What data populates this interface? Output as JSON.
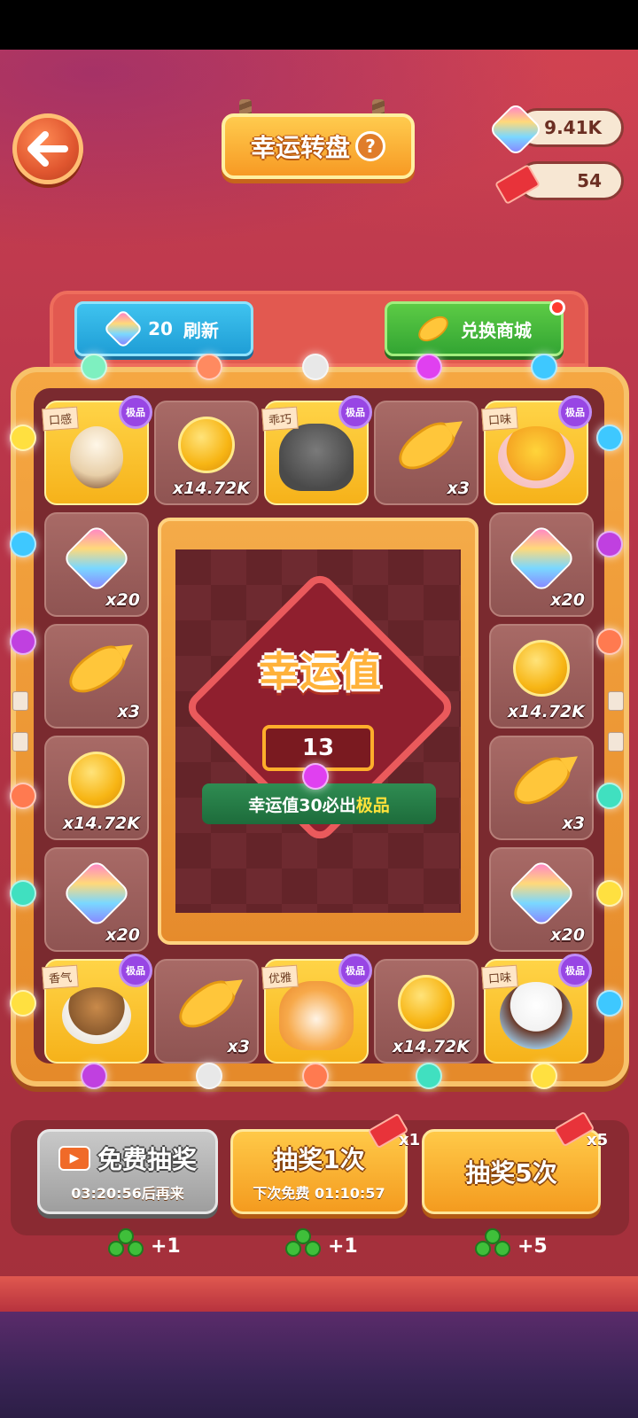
{
  "header": {
    "title": "幸运转盘",
    "help_label": "?",
    "gem_balance": "9.41K",
    "ticket_balance": "54"
  },
  "tabs": {
    "refresh_count": "20",
    "refresh_label": "刷新",
    "shop_label": "兑换商城"
  },
  "grid": {
    "rare_badge": "极品",
    "top_row": [
      {
        "type": "food",
        "tag": "口感",
        "rare": true,
        "item": "coffee-cup"
      },
      {
        "type": "coin",
        "count": "x14.72K"
      },
      {
        "type": "pet",
        "tag": "乖巧",
        "rare": true,
        "item": "gray-cat"
      },
      {
        "type": "fish",
        "count": "x3"
      },
      {
        "type": "food",
        "tag": "口味",
        "rare": true,
        "item": "bee-dish"
      }
    ],
    "left_col": [
      {
        "type": "gem",
        "count": "x20"
      },
      {
        "type": "fish",
        "count": "x3"
      },
      {
        "type": "coin",
        "count": "x14.72K"
      },
      {
        "type": "gem",
        "count": "x20"
      }
    ],
    "right_col": [
      {
        "type": "gem",
        "count": "x20"
      },
      {
        "type": "coin",
        "count": "x14.72K"
      },
      {
        "type": "fish",
        "count": "x3"
      },
      {
        "type": "gem",
        "count": "x20"
      }
    ],
    "bottom_row": [
      {
        "type": "food",
        "tag": "香气",
        "rare": true,
        "item": "bear-latte"
      },
      {
        "type": "fish",
        "count": "x3"
      },
      {
        "type": "pet",
        "tag": "优雅",
        "rare": true,
        "item": "orange-cat"
      },
      {
        "type": "coin",
        "count": "x14.72K"
      },
      {
        "type": "food",
        "tag": "口味",
        "rare": true,
        "item": "panda-cupcake"
      }
    ]
  },
  "luck": {
    "title": "幸运值",
    "value": "13",
    "hint_prefix": "幸运值30必出",
    "hint_highlight": "极品"
  },
  "actions": {
    "free_label": "免费抽奖",
    "free_timer": "03:20:56后再来",
    "one_label": "抽奖1次",
    "one_sub": "下次免费 01:10:57",
    "one_cost": "x1",
    "five_label": "抽奖5次",
    "five_cost": "x5",
    "reward_free": "+1",
    "reward_one": "+1",
    "reward_five": "+5"
  },
  "colors": {
    "bulbs": [
      "#7ef0c0",
      "#ff8a60",
      "#e8e8e8",
      "#e040f0",
      "#3ec8ff",
      "#ffe040",
      "#3ec8ff",
      "#c040e0",
      "#ff7a50",
      "#40e0c0",
      "#ffe040",
      "#3ec8ff",
      "#c040e0",
      "#ff7a50",
      "#40e0c0",
      "#ffe040",
      "#3ec8ff",
      "#c040e0",
      "#e8e8e8",
      "#ff7a50",
      "#40e0c0",
      "#ffe040",
      "#e040f0"
    ]
  }
}
